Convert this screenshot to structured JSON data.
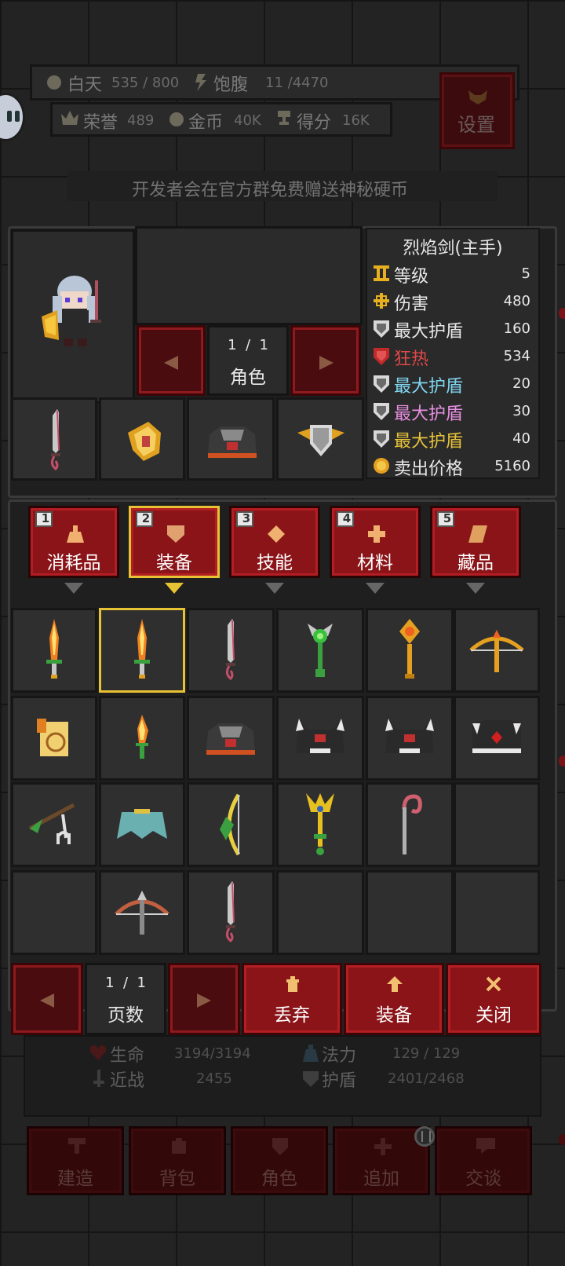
{
  "hud": {
    "day_label": "白天",
    "day_value": "535 / 800",
    "food_label": "饱腹",
    "food_value": "11 /4470",
    "honor_label": "荣誉",
    "honor_value": "489",
    "gold_label": "金币",
    "gold_value": "40K",
    "score_label": "得分",
    "score_value": "16K",
    "settings_label": "设置",
    "notice": "开发者会在官方群免费赠送神秘硬币"
  },
  "character": {
    "page": "1  /  1",
    "label": "角色"
  },
  "item_info": {
    "name": "烈焰剑(主手)",
    "stats": [
      {
        "label": "等级",
        "value": "5",
        "color": "#e8e8e8",
        "icon": "level-icon"
      },
      {
        "label": "伤害",
        "value": "480",
        "color": "#e8e8e8",
        "icon": "damage-icon"
      },
      {
        "label": "最大护盾",
        "value": "160",
        "color": "#e8e8e8",
        "icon": "shield-icon"
      },
      {
        "label": "狂热",
        "value": "534",
        "color": "#e04848",
        "icon": "frenzy-icon"
      },
      {
        "label": "最大护盾",
        "value": "20",
        "color": "#7fd6f0",
        "icon": "shield-icon"
      },
      {
        "label": "最大护盾",
        "value": "30",
        "color": "#e58fe0",
        "icon": "shield-icon"
      },
      {
        "label": "最大护盾",
        "value": "40",
        "color": "#e6c23a",
        "icon": "shield-icon"
      },
      {
        "label": "卖出价格",
        "value": "5160",
        "color": "#e8e8e8",
        "icon": "coin-icon"
      }
    ]
  },
  "tabs": [
    {
      "num": "1",
      "label": "消耗品",
      "icon": "potion-icon"
    },
    {
      "num": "2",
      "label": "装备",
      "icon": "armor-icon"
    },
    {
      "num": "3",
      "label": "技能",
      "icon": "skill-icon"
    },
    {
      "num": "4",
      "label": "材料",
      "icon": "material-icon"
    },
    {
      "num": "5",
      "label": "藏品",
      "icon": "scroll-icon"
    }
  ],
  "inventory": {
    "page": "1  /  1",
    "page_label": "页数",
    "discard": "丢弃",
    "equip": "装备",
    "close": "关闭"
  },
  "bottom_stats": {
    "hp_label": "生命",
    "hp_value": "3194/3194",
    "mp_label": "法力",
    "mp_value": "129 / 129",
    "melee_label": "近战",
    "melee_value": "2455",
    "shield_label": "护盾",
    "shield_value": "2401/2468"
  },
  "bottom_menu": [
    "建造",
    "背包",
    "角色",
    "追加",
    "交谈"
  ],
  "colors": {
    "accent_red": "#7a1216",
    "gold": "#e7c232",
    "panel": "#2b2b2b"
  }
}
